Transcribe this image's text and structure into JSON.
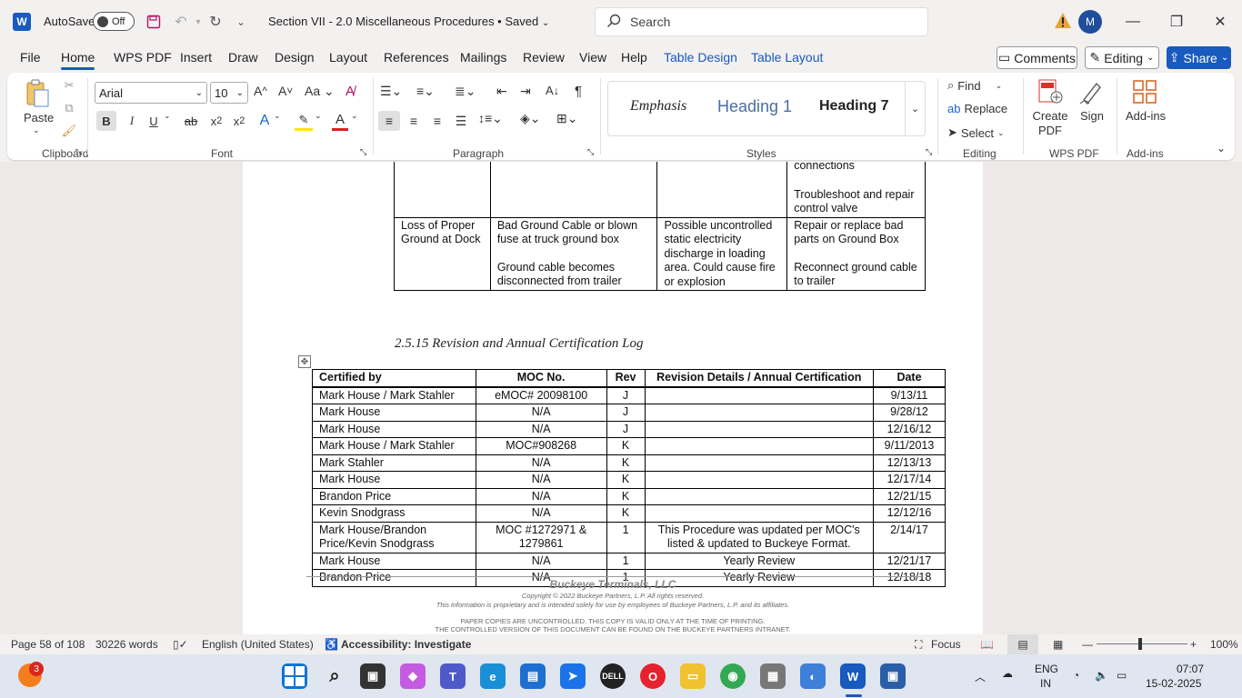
{
  "titlebar": {
    "app_letter": "W",
    "autosave_label": "AutoSave",
    "autosave_state": "Off",
    "doc_title": "Section VII - 2.0 Miscellaneous Procedures • Saved",
    "search_placeholder": "Search",
    "avatar_initial": "M"
  },
  "tabs": [
    "File",
    "Home",
    "WPS PDF",
    "Insert",
    "Draw",
    "Design",
    "Layout",
    "References",
    "Mailings",
    "Review",
    "View",
    "Help",
    "Table Design",
    "Table Layout"
  ],
  "actions": {
    "comments": "Comments",
    "editing": "Editing",
    "share": "Share"
  },
  "ribbon": {
    "paste": "Paste",
    "font_name": "Arial",
    "font_size": "10",
    "styles": [
      "Emphasis",
      "Heading 1",
      "Heading 7"
    ],
    "find": "Find",
    "replace": "Replace",
    "select": "Select",
    "create_pdf": "Create PDF",
    "sign": "Sign",
    "addins": "Add-ins",
    "groups": {
      "clipboard": "Clipboard",
      "font": "Font",
      "paragraph": "Paragraph",
      "styles": "Styles",
      "editing": "Editing",
      "wps_pdf": "WPS PDF",
      "addins": "Add-ins"
    }
  },
  "doc": {
    "top_table": {
      "row1": [
        "",
        "",
        "",
        "connections",
        "Troubleshoot and repair control valve"
      ],
      "row2": {
        "c1": "Loss of Proper Ground at Dock",
        "c2a": "Bad Ground Cable or blown fuse at truck ground box",
        "c2b": "Ground cable becomes disconnected from trailer",
        "c3": "Possible uncontrolled static electricity discharge in loading area. Could cause fire or explosion",
        "c4a": "Repair or replace bad parts on Ground Box",
        "c4b": "Reconnect ground cable to trailer"
      }
    },
    "section_heading": "2.5.15  Revision and Annual Certification Log",
    "log_headers": [
      "Certified by",
      "MOC No.",
      "Rev",
      "Revision Details / Annual Certification",
      "Date"
    ],
    "log_rows": [
      [
        "Mark House / Mark Stahler",
        "eMOC# 20098100",
        "J",
        "",
        "9/13/11"
      ],
      [
        "Mark House",
        "N/A",
        "J",
        "",
        "9/28/12"
      ],
      [
        "Mark House",
        "N/A",
        "J",
        "",
        "12/16/12"
      ],
      [
        "Mark House / Mark Stahler",
        "MOC#908268",
        "K",
        "",
        "9/11/2013"
      ],
      [
        "Mark Stahler",
        "N/A",
        "K",
        "",
        "12/13/13"
      ],
      [
        "Mark House",
        "N/A",
        "K",
        "",
        "12/17/14"
      ],
      [
        "Brandon Price",
        "N/A",
        "K",
        "",
        "12/21/15"
      ],
      [
        "Kevin Snodgrass",
        "N/A",
        "K",
        "",
        "12/12/16"
      ],
      [
        "Mark House/Brandon Price/Kevin Snodgrass",
        "MOC #1272971 & 1279861",
        "1",
        "This Procedure was updated per MOC's listed & updated to Buckeye Format.",
        "2/14/17"
      ],
      [
        "Mark House",
        "N/A",
        "1",
        "Yearly Review",
        "12/21/17"
      ],
      [
        "Brandon Price",
        "N/A",
        "1",
        "Yearly Review",
        "12/18/18"
      ]
    ],
    "footer": {
      "company": "Buckeye Terminals, LLC",
      "copyright": "Copyright © 2022 Buckeye Partners, L.P. All rights reserved.",
      "proprietary": "This information is proprietary and is intended solely for use by employees of Buckeye Partners, L.P. and its affiliates.",
      "uncontrolled1": "PAPER COPIES ARE UNCONTROLLED. THIS COPY IS VALID ONLY AT THE TIME OF PRINTING.",
      "uncontrolled2": "THE CONTROLLED VERSION OF THIS DOCUMENT CAN BE FOUND ON THE BUCKEYE PARTNERS INTRANET."
    }
  },
  "status": {
    "page": "Page 58 of 108",
    "words": "30226 words",
    "language": "English (United States)",
    "accessibility": "Accessibility: Investigate",
    "focus": "Focus",
    "zoom": "100%"
  },
  "taskbar": {
    "notification_count": "3",
    "lang1": "ENG",
    "lang2": "IN",
    "time": "07:07",
    "date": "15-02-2025"
  },
  "colors": {
    "accent": "#185abd",
    "titlebar_bg": "#f3f0f0",
    "taskbar_bg": "#dfe6ef"
  }
}
